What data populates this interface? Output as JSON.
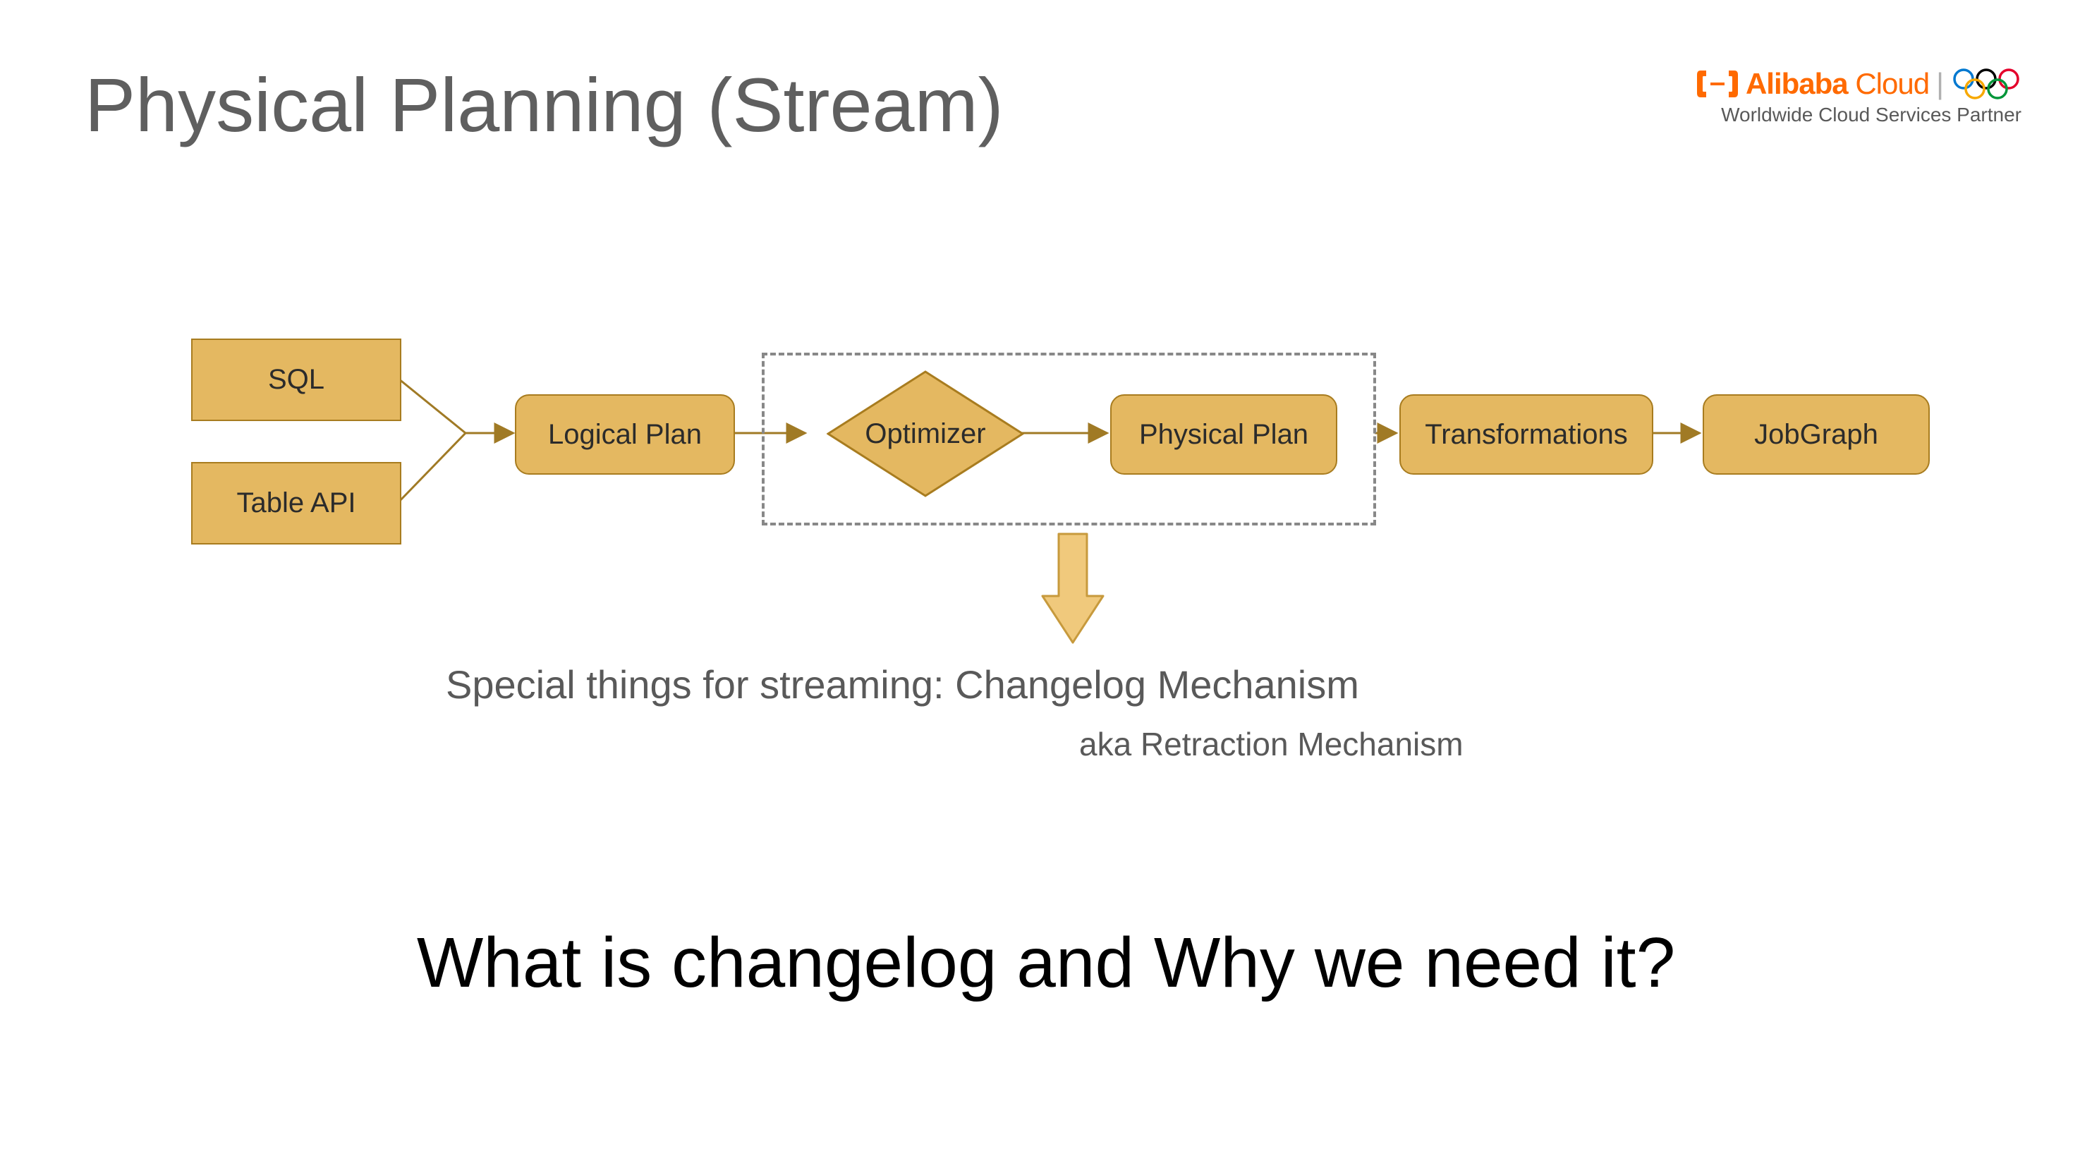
{
  "title": "Physical Planning (Stream)",
  "logo": {
    "name_html": "Alibaba Cloud",
    "subtitle": "Worldwide Cloud Services Partner"
  },
  "boxes": {
    "sql": "SQL",
    "tableapi": "Table API",
    "logical": "Logical Plan",
    "optimizer": "Optimizer",
    "physical": "Physical Plan",
    "transformations": "Transformations",
    "jobgraph": "JobGraph"
  },
  "caption1": "Special things for streaming: Changelog Mechanism",
  "caption2": "aka Retraction Mechanism",
  "question": "What is changelog and Why we need it?",
  "colors": {
    "fill": "#e4b861",
    "stroke": "#a87c1f",
    "arrow": "#a07a25"
  }
}
